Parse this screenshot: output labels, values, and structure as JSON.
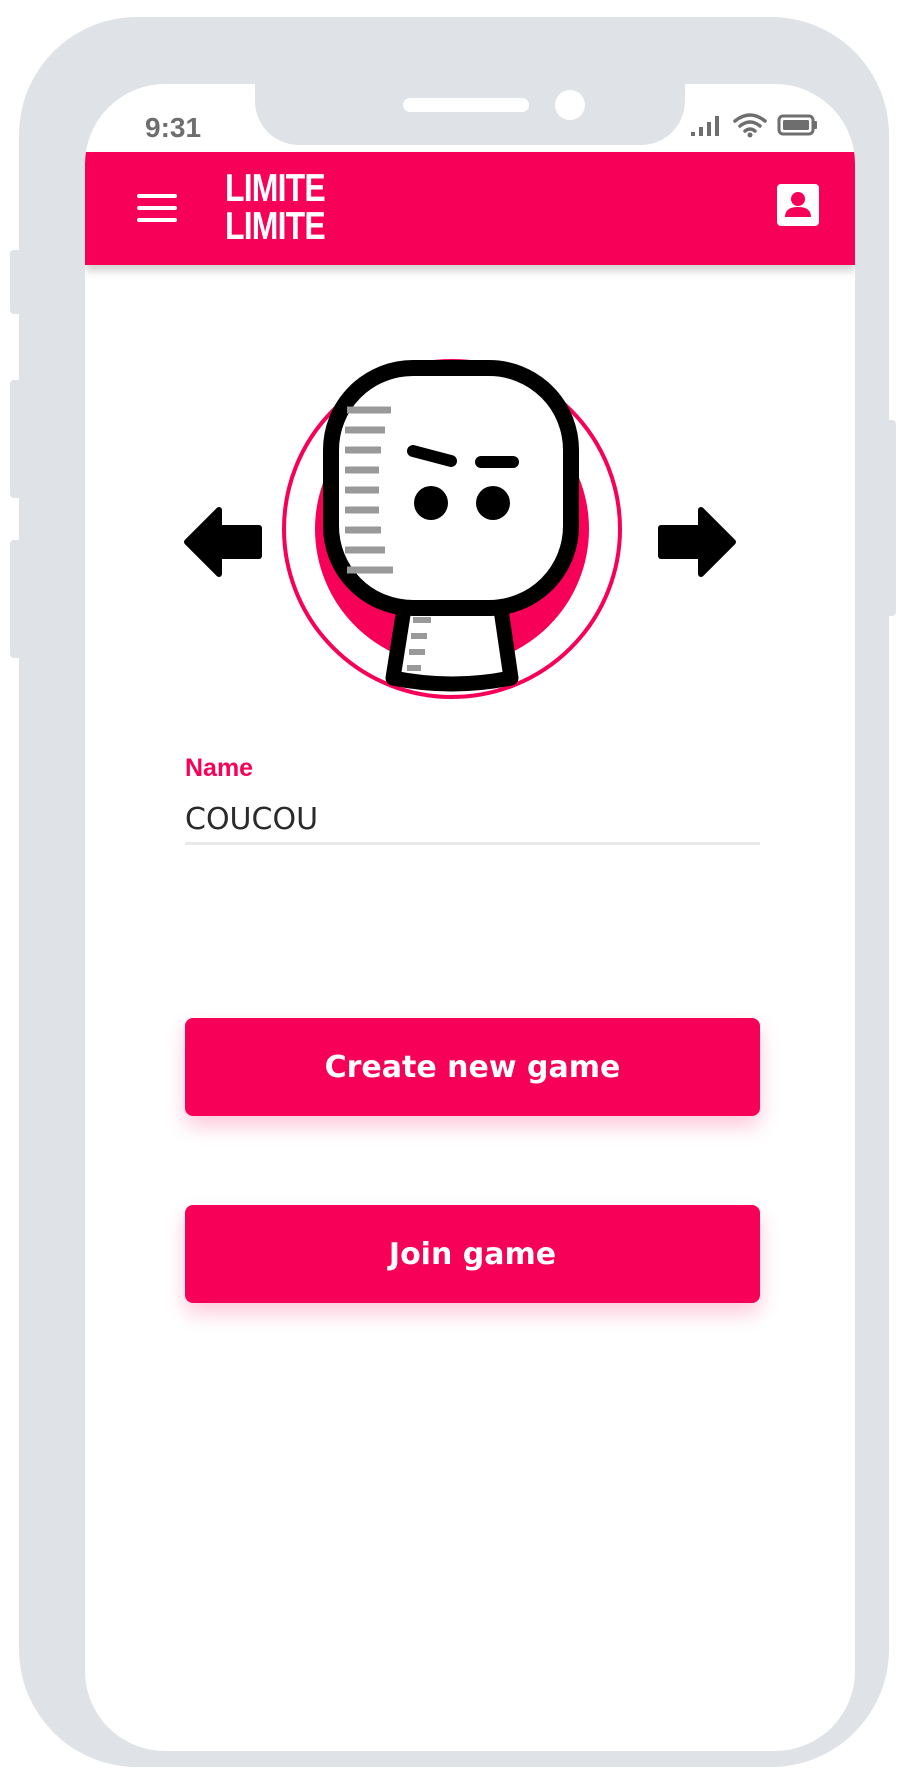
{
  "status_bar": {
    "time": "9:31",
    "icons": [
      "cellular-signal-icon",
      "wifi-icon",
      "battery-icon"
    ]
  },
  "app_bar": {
    "background_color": "#f70057",
    "menu_icon": "hamburger-menu-icon",
    "logo_line1": "LIMITE",
    "logo_line2": "LIMITE",
    "account_icon": "account-box-icon"
  },
  "avatar": {
    "prev_icon": "arrow-left-icon",
    "next_icon": "arrow-right-icon",
    "ring_color": "#f70057"
  },
  "form": {
    "name_label": "Name",
    "name_value": "COUCOU"
  },
  "actions": {
    "create_label": "Create new game",
    "join_label": "Join game"
  },
  "theme": {
    "accent": "#f70057",
    "frame": "#dfe2e6"
  }
}
